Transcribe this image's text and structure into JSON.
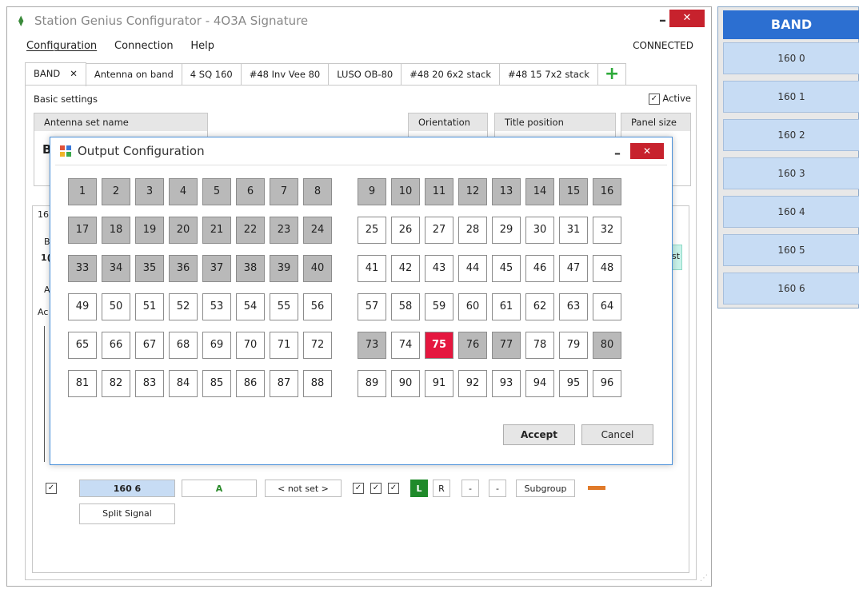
{
  "window": {
    "title": "Station Genius Configurator - 4O3A Signature",
    "minimize": "–",
    "close": "✕",
    "status": "CONNECTED"
  },
  "menu": [
    {
      "label": "Configuration"
    },
    {
      "label": "Connection"
    },
    {
      "label": "Help"
    }
  ],
  "tabs": [
    {
      "label": "BAND",
      "close": "✕"
    },
    {
      "label": "Antenna on band"
    },
    {
      "label": "4 SQ 160"
    },
    {
      "label": "#48 Inv Vee 80"
    },
    {
      "label": "LUSO OB-80"
    },
    {
      "label": "#48 20 6x2 stack"
    },
    {
      "label": "#48 15 7x2 stack"
    },
    {
      "label": "+"
    }
  ],
  "basic": {
    "label": "Basic settings",
    "active_label": "Active",
    "active_checked": "✓",
    "antenna_set_name": "Antenna set name",
    "name_value_partial": "B",
    "orientation": "Orientation",
    "title_position": "Title position",
    "panel_size": "Panel size"
  },
  "fragments": {
    "f1": "16",
    "f2": "B",
    "f3": "1(",
    "f4": "A",
    "f5": "Ac",
    "f6": "st"
  },
  "bottom_row": {
    "checkbox": "✓",
    "band": "160 6",
    "antenna": "A",
    "not_set": "< not set >",
    "chk1": "✓",
    "chk2": "✓",
    "chk3": "✓",
    "l": "L",
    "r": "R",
    "dash1": "-",
    "dash2": "-",
    "subgroup": "Subgroup",
    "split_signal": "Split Signal"
  },
  "dialog": {
    "title": "Output Configuration",
    "minimize": "–",
    "close": "✕",
    "accept": "Accept",
    "cancel": "Cancel",
    "selected_output": 75,
    "active_outputs": [
      1,
      2,
      3,
      4,
      5,
      6,
      7,
      8,
      9,
      10,
      11,
      12,
      13,
      14,
      15,
      16,
      17,
      18,
      19,
      20,
      21,
      22,
      23,
      24,
      33,
      34,
      35,
      36,
      37,
      38,
      39,
      40,
      73,
      76,
      77,
      80
    ]
  },
  "band_panel": {
    "header": "BAND",
    "items": [
      "160 0",
      "160 1",
      "160 2",
      "160 3",
      "160 4",
      "160 5",
      "160 6"
    ]
  },
  "colors": {
    "accent": "#2c6fd1",
    "close_red": "#c7222d",
    "selected_red": "#e5173f",
    "active_gray": "#b9b9b9",
    "green": "#2eaa3a"
  }
}
